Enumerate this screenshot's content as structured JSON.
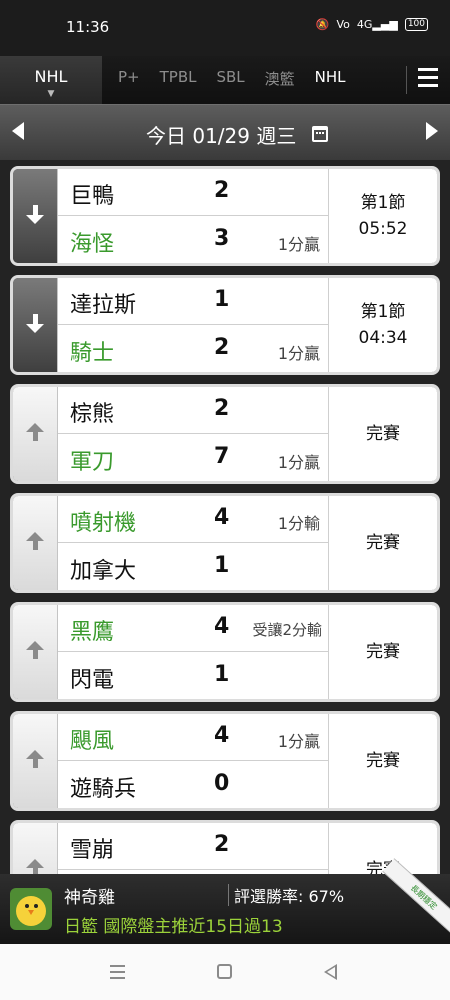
{
  "status_bar": {
    "time": "11:36",
    "icons": [
      "mute-icon",
      "volte-icon",
      "4g-signal-icon",
      "battery-icon"
    ],
    "network_label": "4G",
    "battery": "100"
  },
  "league_nav": {
    "active": "NHL",
    "tabs": [
      "P+",
      "TPBL",
      "SBL",
      "澳籃",
      "NHL"
    ],
    "menu_icon": "hamburger-menu-icon"
  },
  "date_bar": {
    "date_text": "今日 01/29 週三",
    "prev_icon": "chevron-left-icon",
    "next_icon": "chevron-right-icon",
    "calendar_icon": "calendar-icon"
  },
  "games": [
    {
      "side": "live",
      "top": {
        "team": "巨鴨",
        "score": "2",
        "result": "",
        "win": false
      },
      "bottom": {
        "team": "海怪",
        "score": "3",
        "result": "1分贏",
        "win": true
      },
      "status_line1": "第1節",
      "status_line2": "05:52"
    },
    {
      "side": "live",
      "top": {
        "team": "達拉斯",
        "score": "1",
        "result": "",
        "win": false
      },
      "bottom": {
        "team": "騎士",
        "score": "2",
        "result": "1分贏",
        "win": true
      },
      "status_line1": "第1節",
      "status_line2": "04:34"
    },
    {
      "side": "final",
      "top": {
        "team": "棕熊",
        "score": "2",
        "result": "",
        "win": false
      },
      "bottom": {
        "team": "軍刀",
        "score": "7",
        "result": "1分贏",
        "win": true
      },
      "status_line1": "完賽",
      "status_line2": ""
    },
    {
      "side": "final",
      "top": {
        "team": "噴射機",
        "score": "4",
        "result": "1分輸",
        "win": true
      },
      "bottom": {
        "team": "加拿大",
        "score": "1",
        "result": "",
        "win": false
      },
      "status_line1": "完賽",
      "status_line2": ""
    },
    {
      "side": "final",
      "top": {
        "team": "黑鷹",
        "score": "4",
        "result": "受讓2分輸",
        "win": true
      },
      "bottom": {
        "team": "閃電",
        "score": "1",
        "result": "",
        "win": false
      },
      "status_line1": "完賽",
      "status_line2": ""
    },
    {
      "side": "final",
      "top": {
        "team": "颶風",
        "score": "4",
        "result": "1分贏",
        "win": true
      },
      "bottom": {
        "team": "遊騎兵",
        "score": "0",
        "result": "",
        "win": false
      },
      "status_line1": "完賽",
      "status_line2": ""
    },
    {
      "side": "final",
      "top": {
        "team": "雪崩",
        "score": "2",
        "result": "",
        "win": false
      },
      "bottom": {
        "team": "",
        "score": "",
        "result": "",
        "win": false
      },
      "status_line1": "完賽",
      "status_line2": ""
    }
  ],
  "expert_banner": {
    "name": "神奇雞",
    "win_rate": "評選勝率: 67%",
    "pick": "日籃 國際盤主推近15日過13",
    "ribbon": "長期穩定"
  },
  "android_nav": {
    "recent_icon": "recent-apps-icon",
    "home_icon": "home-icon",
    "back_icon": "back-icon"
  },
  "colors": {
    "win_green": "#3a9a2d",
    "pick_green": "#9bd23a",
    "header_dark": "#1c1c1c"
  }
}
